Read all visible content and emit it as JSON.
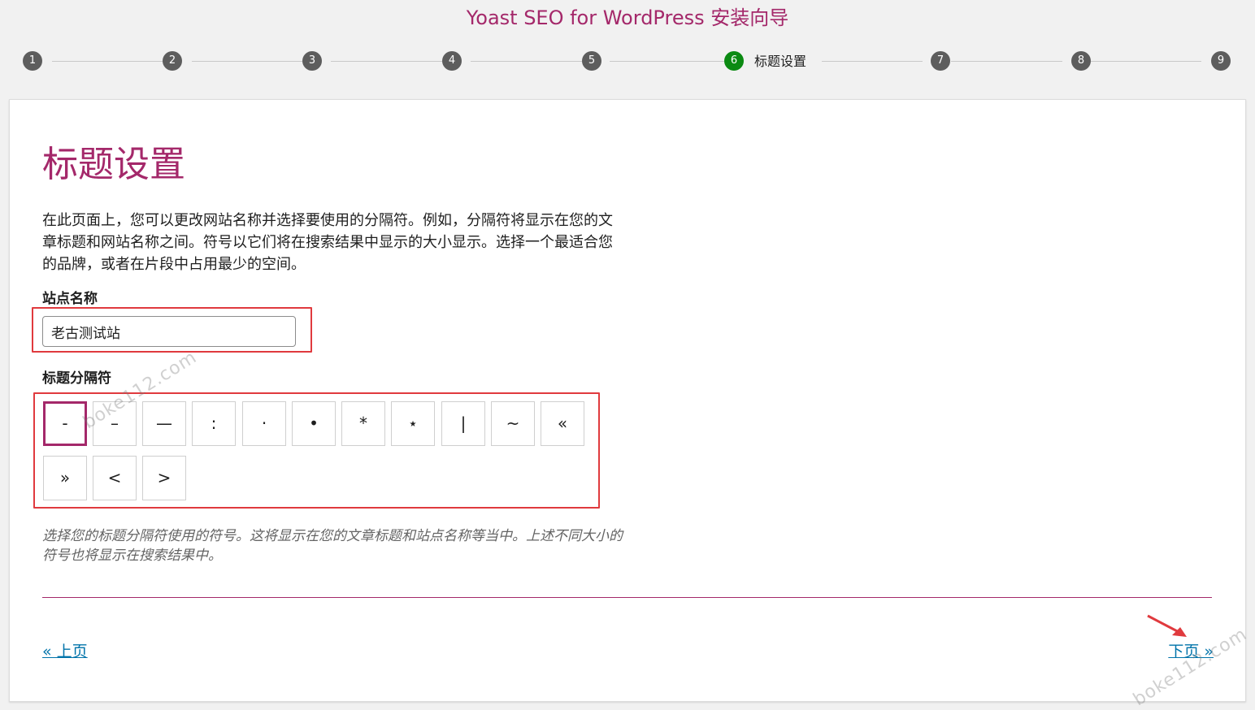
{
  "wizard": {
    "title": "Yoast SEO for WordPress 安装向导",
    "steps": [
      {
        "number": "1",
        "label": ""
      },
      {
        "number": "2",
        "label": ""
      },
      {
        "number": "3",
        "label": ""
      },
      {
        "number": "4",
        "label": ""
      },
      {
        "number": "5",
        "label": ""
      },
      {
        "number": "6",
        "label": "标题设置",
        "active": true
      },
      {
        "number": "7",
        "label": ""
      },
      {
        "number": "8",
        "label": ""
      },
      {
        "number": "9",
        "label": ""
      }
    ]
  },
  "main": {
    "heading": "标题设置",
    "intro": "在此页面上，您可以更改网站名称并选择要使用的分隔符。例如，分隔符将显示在您的文章标题和网站名称之间。符号以它们将在搜索结果中显示的大小显示。选择一个最适合您的品牌，或者在片段中占用最少的空间。",
    "site_name_label": "站点名称",
    "site_name_value": "老古测试站",
    "separator_label": "标题分隔符",
    "separators": [
      "-",
      "–",
      "—",
      ":",
      "·",
      "•",
      "*",
      "⋆",
      "|",
      "~",
      "«",
      "»",
      "<",
      ">"
    ],
    "selected_separator": "-",
    "help_text": "选择您的标题分隔符使用的符号。这将显示在您的文章标题和站点名称等当中。上述不同大小的符号也将显示在搜索结果中。"
  },
  "nav": {
    "prev_label": "« 上页",
    "next_label": "下页 »"
  },
  "watermarks": [
    "boke112.com",
    "boke112.com"
  ],
  "colors": {
    "brand": "#a4286a",
    "active_step": "#0b8a12",
    "link": "#0073aa",
    "annotation": "#e03a3e"
  }
}
